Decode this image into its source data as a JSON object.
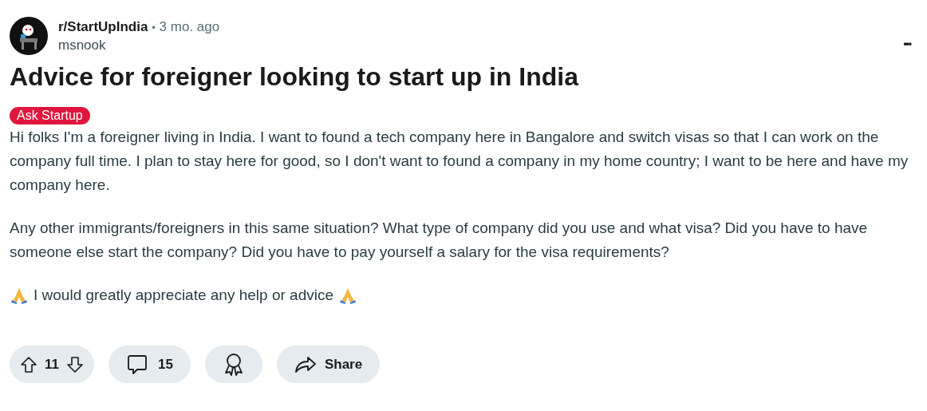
{
  "post": {
    "subreddit": "r/StartUpIndia",
    "separator": "•",
    "age": "3 mo. ago",
    "author": "msnook",
    "more": "•••",
    "title": "Advice for foreigner looking to start up in India",
    "flair": "Ask Startup",
    "paragraphs": [
      {
        "kind": "text",
        "text": "Hi folks I'm a foreigner living in India. I want to found a tech company here in Bangalore and switch visas so that I can work on the company full time. I plan to stay here for good, so I don't want to found a company in my home country; I want to be here and have my company here."
      },
      {
        "kind": "text",
        "text": "Any other immigrants/foreigners in this same situation? What type of company did you use and what visa? Did you have to have someone else start the company? Did you have to pay yourself a salary for the visa requirements?"
      },
      {
        "kind": "praying",
        "text": "I would greatly appreciate any help or advice"
      }
    ]
  },
  "actions": {
    "votes": "11",
    "comments": "15",
    "share": "Share"
  }
}
